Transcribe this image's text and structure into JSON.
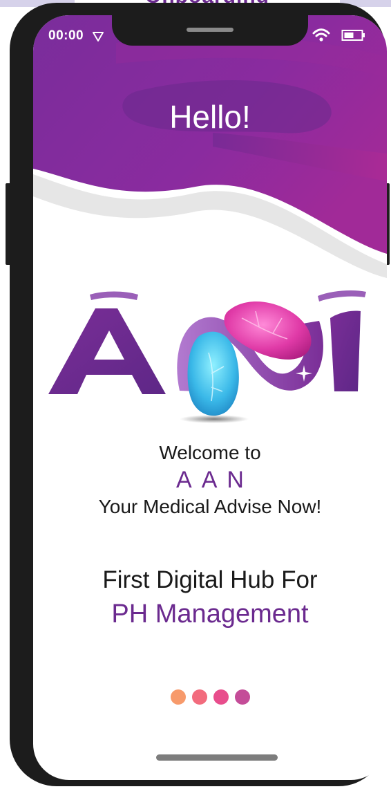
{
  "status_bar": {
    "time": "00:00",
    "icons": [
      "signal-triangle-icon",
      "wifi-icon",
      "battery-icon"
    ]
  },
  "header": {
    "greeting": "Hello!"
  },
  "logo": {
    "brand_letters": "ĀNĪ",
    "icon": "lungs-logo-icon"
  },
  "welcome": {
    "line1": "Welcome to",
    "brand": "AAN",
    "tagline": "Your Medical Advise Now!"
  },
  "hub": {
    "line1": "First Digital Hub For",
    "line2": "PH Management"
  },
  "pagination": {
    "count": 4,
    "colors": [
      "#f79a6b",
      "#f26b7d",
      "#e84d8c",
      "#c44c98"
    ]
  },
  "colors": {
    "brand_purple": "#6b2a8f",
    "header_purple": "#7b2c9c",
    "header_magenta": "#a22a97",
    "phone_body": "#1c1c1c"
  }
}
